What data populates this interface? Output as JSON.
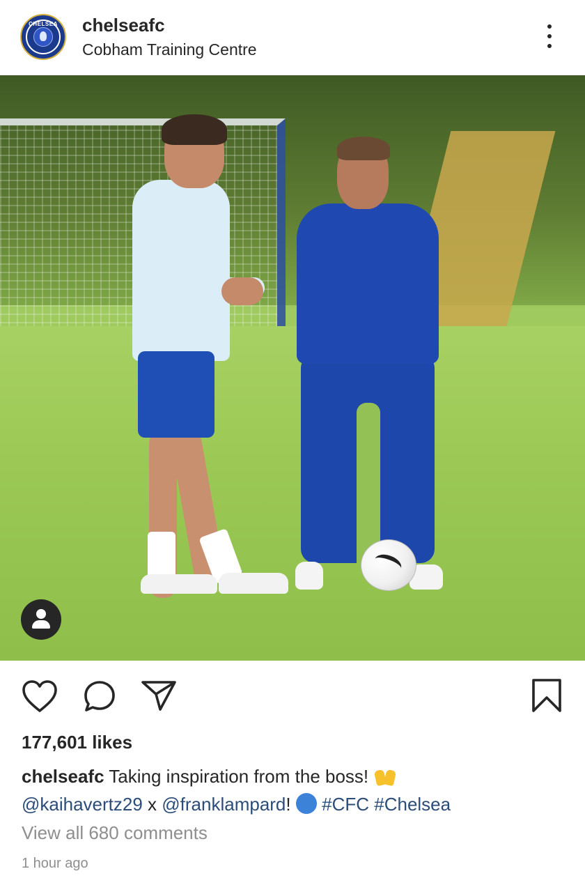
{
  "post": {
    "account_name": "chelseafc",
    "location": "Cobham Training Centre",
    "avatar_badge_text": "CHELSEA",
    "likes_text": "177,601 likes",
    "caption": {
      "username": "chelseafc",
      "text_line1": "Taking inspiration from the boss!",
      "mention1": "@kaihavertz29",
      "joiner": " x ",
      "mention2": "@franklampard",
      "after_mention": "!",
      "hashtag1": "#CFC",
      "hashtag2": "#Chelsea"
    },
    "view_comments": "View all 680 comments",
    "timestamp": "1 hour ago"
  },
  "icons": {
    "more": "more-vertical-icon",
    "tag": "user-tag-icon",
    "like": "heart-icon",
    "comment": "comment-bubble-icon",
    "share": "paper-plane-icon",
    "save": "bookmark-icon"
  },
  "colors": {
    "text": "#262626",
    "link": "#2b4d7a",
    "muted": "#8e8e8e",
    "chelsea_blue": "#1b3a8c"
  }
}
